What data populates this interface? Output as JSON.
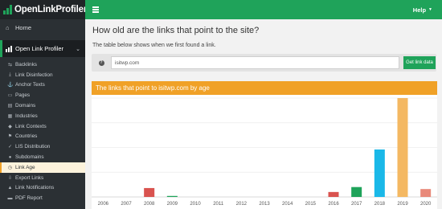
{
  "app": {
    "logo_text": "OpenLinkProfiler"
  },
  "sidebar": {
    "home": {
      "label": "Home",
      "icon": "home-icon"
    },
    "section": {
      "label": "Open Link Profiler"
    },
    "items": [
      {
        "label": "Backlinks",
        "icon": "backlinks-icon",
        "glyph": "⇆"
      },
      {
        "label": "Link Disinfection",
        "icon": "download-icon",
        "glyph": "⤓"
      },
      {
        "label": "Anchor Texts",
        "icon": "anchor-icon",
        "glyph": "⚓"
      },
      {
        "label": "Pages",
        "icon": "page-icon",
        "glyph": "▭"
      },
      {
        "label": "Domains",
        "icon": "server-icon",
        "glyph": "▤"
      },
      {
        "label": "Industries",
        "icon": "building-icon",
        "glyph": "▦"
      },
      {
        "label": "Link Contexts",
        "icon": "tag-icon",
        "glyph": "◆"
      },
      {
        "label": "Countries",
        "icon": "flag-icon",
        "glyph": "⚑"
      },
      {
        "label": "LIS Distribution",
        "icon": "chart-icon",
        "glyph": "✓"
      },
      {
        "label": "Subdomains",
        "icon": "globe-icon",
        "glyph": "●"
      },
      {
        "label": "Link Age",
        "icon": "clock-icon",
        "glyph": "◷"
      },
      {
        "label": "Export Links",
        "icon": "export-icon",
        "glyph": "⇩"
      },
      {
        "label": "Link Notifications",
        "icon": "bell-icon",
        "glyph": "▲"
      },
      {
        "label": "PDF Report",
        "icon": "pdf-icon",
        "glyph": "▬"
      }
    ],
    "active_index": 10
  },
  "topbar": {
    "help_label": "Help"
  },
  "page": {
    "title": "How old are the links that point to the site?",
    "description": "The table below shows when we first found a link."
  },
  "search": {
    "value": "isitwp.com",
    "button_label": "Get link data"
  },
  "chart_panel": {
    "title": "The links that point to isitwp.com by age"
  },
  "chart_data": {
    "type": "bar",
    "title": "The links that point to isitwp.com by age",
    "categories": [
      "2006",
      "2007",
      "2008",
      "2009",
      "2010",
      "2011",
      "2012",
      "2013",
      "2014",
      "2015",
      "2016",
      "2017",
      "2018",
      "2019",
      "2020"
    ],
    "values": [
      0,
      0,
      9,
      1,
      0,
      0,
      0,
      0,
      0,
      0,
      5,
      10,
      48,
      100,
      8
    ],
    "colors": [
      "#d9534f",
      "#d9534f",
      "#d9534f",
      "#1fa35a",
      "#1fa35a",
      "#1fa35a",
      "#1fa35a",
      "#1fa35a",
      "#1fa35a",
      "#1fa35a",
      "#d9534f",
      "#1fa35a",
      "#1ab8e8",
      "#f4b862",
      "#e8897a"
    ],
    "ylim": [
      0,
      100
    ],
    "grid": true,
    "xlabel": "",
    "ylabel": ""
  },
  "colors": {
    "accent": "#1fa35a",
    "header": "#f0a127",
    "sidebar_bg": "#2b3034"
  }
}
